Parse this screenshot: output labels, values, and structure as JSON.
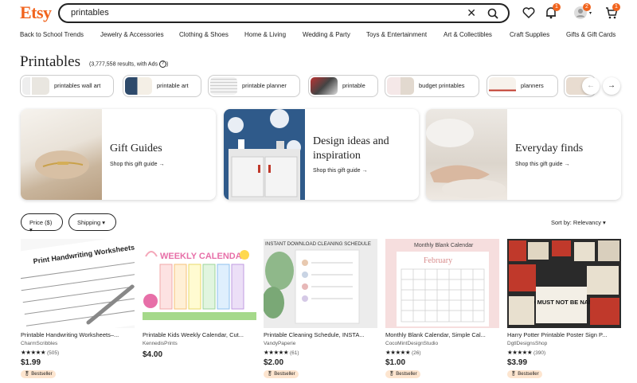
{
  "header": {
    "logo": "Etsy",
    "search_value": "printables",
    "clear_glyph": "✕",
    "notif_badge": "1",
    "account_badge": "2",
    "cart_badge": "1"
  },
  "categories": [
    "Back to School Trends",
    "Jewelry & Accessories",
    "Clothing & Shoes",
    "Home & Living",
    "Wedding & Party",
    "Toys & Entertainment",
    "Art & Collectibles",
    "Craft Supplies",
    "Gifts & Gift Cards"
  ],
  "page": {
    "title": "Printables",
    "results": "(3,777,558 results, with Ads",
    "help": "?"
  },
  "chips": [
    "printables wall art",
    "printable art",
    "printable planner",
    "printable",
    "budget printables",
    "planners"
  ],
  "carousel": {
    "prev": "←",
    "next": "→"
  },
  "promos": [
    {
      "title_line1": "Gift Guides",
      "title_line2": "",
      "link": "Shop this gift guide →"
    },
    {
      "title_line1": "Design ideas and",
      "title_line2": "inspiration",
      "link": "Shop this gift guide →"
    },
    {
      "title_line1": "Everyday finds",
      "title_line2": "",
      "link": "Shop this gift guide →"
    }
  ],
  "filters": {
    "price": "Price ($) ▾",
    "shipping": "Shipping ▾",
    "sort": "Sort by: Relevancy ▾"
  },
  "products": [
    {
      "title": "Printable Handwriting Worksheets–...",
      "shop": "CharmScribbles",
      "stars": "★★★★★",
      "reviews": "(505)",
      "price": "$1.99",
      "badge": "Bestseller",
      "img_text": "Print Handwriting Worksheets"
    },
    {
      "title": "Printable Kids Weekly Calendar, Cut...",
      "shop": "KennedisPrints",
      "stars": "",
      "reviews": "",
      "price": "$4.00",
      "badge": "",
      "img_text": "WEEKLY CALENDAR"
    },
    {
      "title": "Printable Cleaning Schedule, INSTA...",
      "shop": "VandyPaperie",
      "stars": "★★★★★",
      "reviews": "(61)",
      "price": "$2.00",
      "badge": "Bestseller",
      "img_text": "INSTANT DOWNLOAD CLEANING SCHEDULE"
    },
    {
      "title": "Monthly Blank Calendar, Simple Cal...",
      "shop": "CocoMintDesignStudio",
      "stars": "★★★★★",
      "reviews": "(26)",
      "price": "$1.00",
      "badge": "Bestseller",
      "img_text": "Monthly Blank Calendar"
    },
    {
      "title": "Harry Potter Printable Poster Sign P...",
      "shop": "DgtlDesignsShop",
      "stars": "★★★★★",
      "reviews": "(390)",
      "price": "$3.99",
      "badge": "Bestseller",
      "img_text": "WHO MUST NOT BE NAMED"
    }
  ],
  "colors": {
    "brand": "#f1641e",
    "badge_bg": "#fde5cf"
  }
}
